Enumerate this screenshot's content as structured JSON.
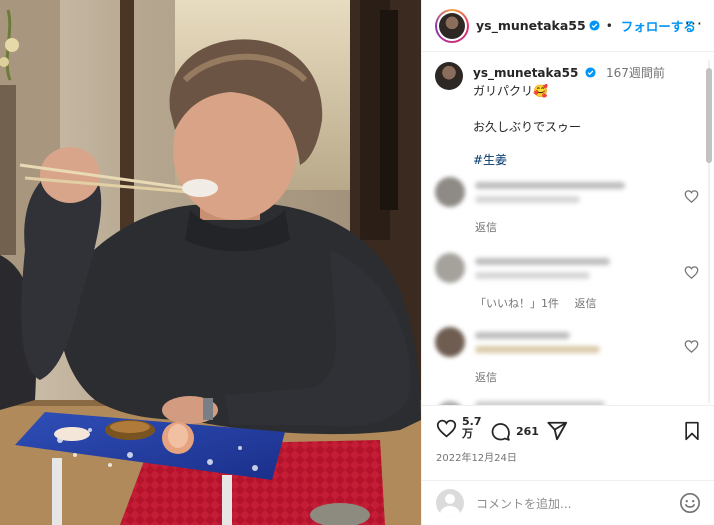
{
  "header": {
    "username": "ys_munetaka55",
    "follow_label": "フォローする"
  },
  "caption": {
    "username": "ys_munetaka55",
    "timestamp": "167週間前",
    "line1": "ガリパクリ🥰",
    "line2": "お久しぶりでスゥー",
    "hashtag": "#生姜"
  },
  "comments": [
    {
      "reply_label": "返信",
      "likes_label": ""
    },
    {
      "reply_label": "返信",
      "likes_label": "「いいね！」1件"
    },
    {
      "reply_label": "返信",
      "likes_label": ""
    }
  ],
  "actions": {
    "like_count_line1": "5.7",
    "like_count_line2": "万",
    "comment_count": "261",
    "date": "2022年12月24日"
  },
  "add_comment": {
    "placeholder": "コメントを追加..."
  },
  "colors": {
    "accent": "#0095f6",
    "hashtag": "#00376b",
    "verified": "#0095f6",
    "muted": "#737373"
  },
  "icons": {
    "verified": "verified-badge-icon",
    "heart": "heart-icon",
    "comment": "comment-bubble-icon",
    "share": "paper-plane-icon",
    "save": "bookmark-icon",
    "emoji": "smiley-icon",
    "more": "more-horizontal-icon"
  }
}
